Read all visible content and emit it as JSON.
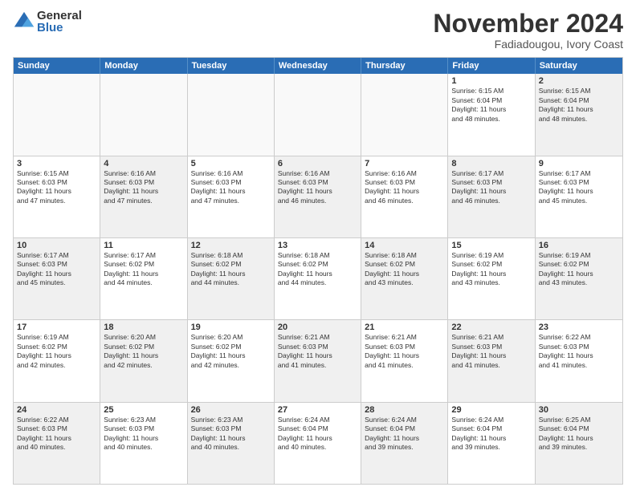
{
  "logo": {
    "general": "General",
    "blue": "Blue"
  },
  "header": {
    "month": "November 2024",
    "location": "Fadiadougou, Ivory Coast"
  },
  "weekdays": [
    "Sunday",
    "Monday",
    "Tuesday",
    "Wednesday",
    "Thursday",
    "Friday",
    "Saturday"
  ],
  "rows": [
    [
      {
        "day": "",
        "info": "",
        "empty": true
      },
      {
        "day": "",
        "info": "",
        "empty": true
      },
      {
        "day": "",
        "info": "",
        "empty": true
      },
      {
        "day": "",
        "info": "",
        "empty": true
      },
      {
        "day": "",
        "info": "",
        "empty": true
      },
      {
        "day": "1",
        "info": "Sunrise: 6:15 AM\nSunset: 6:04 PM\nDaylight: 11 hours\nand 48 minutes.",
        "empty": false
      },
      {
        "day": "2",
        "info": "Sunrise: 6:15 AM\nSunset: 6:04 PM\nDaylight: 11 hours\nand 48 minutes.",
        "empty": false,
        "shaded": true
      }
    ],
    [
      {
        "day": "3",
        "info": "Sunrise: 6:15 AM\nSunset: 6:03 PM\nDaylight: 11 hours\nand 47 minutes.",
        "empty": false
      },
      {
        "day": "4",
        "info": "Sunrise: 6:16 AM\nSunset: 6:03 PM\nDaylight: 11 hours\nand 47 minutes.",
        "empty": false,
        "shaded": true
      },
      {
        "day": "5",
        "info": "Sunrise: 6:16 AM\nSunset: 6:03 PM\nDaylight: 11 hours\nand 47 minutes.",
        "empty": false
      },
      {
        "day": "6",
        "info": "Sunrise: 6:16 AM\nSunset: 6:03 PM\nDaylight: 11 hours\nand 46 minutes.",
        "empty": false,
        "shaded": true
      },
      {
        "day": "7",
        "info": "Sunrise: 6:16 AM\nSunset: 6:03 PM\nDaylight: 11 hours\nand 46 minutes.",
        "empty": false
      },
      {
        "day": "8",
        "info": "Sunrise: 6:17 AM\nSunset: 6:03 PM\nDaylight: 11 hours\nand 46 minutes.",
        "empty": false,
        "shaded": true
      },
      {
        "day": "9",
        "info": "Sunrise: 6:17 AM\nSunset: 6:03 PM\nDaylight: 11 hours\nand 45 minutes.",
        "empty": false
      }
    ],
    [
      {
        "day": "10",
        "info": "Sunrise: 6:17 AM\nSunset: 6:03 PM\nDaylight: 11 hours\nand 45 minutes.",
        "empty": false,
        "shaded": true
      },
      {
        "day": "11",
        "info": "Sunrise: 6:17 AM\nSunset: 6:02 PM\nDaylight: 11 hours\nand 44 minutes.",
        "empty": false
      },
      {
        "day": "12",
        "info": "Sunrise: 6:18 AM\nSunset: 6:02 PM\nDaylight: 11 hours\nand 44 minutes.",
        "empty": false,
        "shaded": true
      },
      {
        "day": "13",
        "info": "Sunrise: 6:18 AM\nSunset: 6:02 PM\nDaylight: 11 hours\nand 44 minutes.",
        "empty": false
      },
      {
        "day": "14",
        "info": "Sunrise: 6:18 AM\nSunset: 6:02 PM\nDaylight: 11 hours\nand 43 minutes.",
        "empty": false,
        "shaded": true
      },
      {
        "day": "15",
        "info": "Sunrise: 6:19 AM\nSunset: 6:02 PM\nDaylight: 11 hours\nand 43 minutes.",
        "empty": false
      },
      {
        "day": "16",
        "info": "Sunrise: 6:19 AM\nSunset: 6:02 PM\nDaylight: 11 hours\nand 43 minutes.",
        "empty": false,
        "shaded": true
      }
    ],
    [
      {
        "day": "17",
        "info": "Sunrise: 6:19 AM\nSunset: 6:02 PM\nDaylight: 11 hours\nand 42 minutes.",
        "empty": false
      },
      {
        "day": "18",
        "info": "Sunrise: 6:20 AM\nSunset: 6:02 PM\nDaylight: 11 hours\nand 42 minutes.",
        "empty": false,
        "shaded": true
      },
      {
        "day": "19",
        "info": "Sunrise: 6:20 AM\nSunset: 6:02 PM\nDaylight: 11 hours\nand 42 minutes.",
        "empty": false
      },
      {
        "day": "20",
        "info": "Sunrise: 6:21 AM\nSunset: 6:03 PM\nDaylight: 11 hours\nand 41 minutes.",
        "empty": false,
        "shaded": true
      },
      {
        "day": "21",
        "info": "Sunrise: 6:21 AM\nSunset: 6:03 PM\nDaylight: 11 hours\nand 41 minutes.",
        "empty": false
      },
      {
        "day": "22",
        "info": "Sunrise: 6:21 AM\nSunset: 6:03 PM\nDaylight: 11 hours\nand 41 minutes.",
        "empty": false,
        "shaded": true
      },
      {
        "day": "23",
        "info": "Sunrise: 6:22 AM\nSunset: 6:03 PM\nDaylight: 11 hours\nand 41 minutes.",
        "empty": false
      }
    ],
    [
      {
        "day": "24",
        "info": "Sunrise: 6:22 AM\nSunset: 6:03 PM\nDaylight: 11 hours\nand 40 minutes.",
        "empty": false,
        "shaded": true
      },
      {
        "day": "25",
        "info": "Sunrise: 6:23 AM\nSunset: 6:03 PM\nDaylight: 11 hours\nand 40 minutes.",
        "empty": false
      },
      {
        "day": "26",
        "info": "Sunrise: 6:23 AM\nSunset: 6:03 PM\nDaylight: 11 hours\nand 40 minutes.",
        "empty": false,
        "shaded": true
      },
      {
        "day": "27",
        "info": "Sunrise: 6:24 AM\nSunset: 6:04 PM\nDaylight: 11 hours\nand 40 minutes.",
        "empty": false
      },
      {
        "day": "28",
        "info": "Sunrise: 6:24 AM\nSunset: 6:04 PM\nDaylight: 11 hours\nand 39 minutes.",
        "empty": false,
        "shaded": true
      },
      {
        "day": "29",
        "info": "Sunrise: 6:24 AM\nSunset: 6:04 PM\nDaylight: 11 hours\nand 39 minutes.",
        "empty": false
      },
      {
        "day": "30",
        "info": "Sunrise: 6:25 AM\nSunset: 6:04 PM\nDaylight: 11 hours\nand 39 minutes.",
        "empty": false,
        "shaded": true
      }
    ]
  ]
}
